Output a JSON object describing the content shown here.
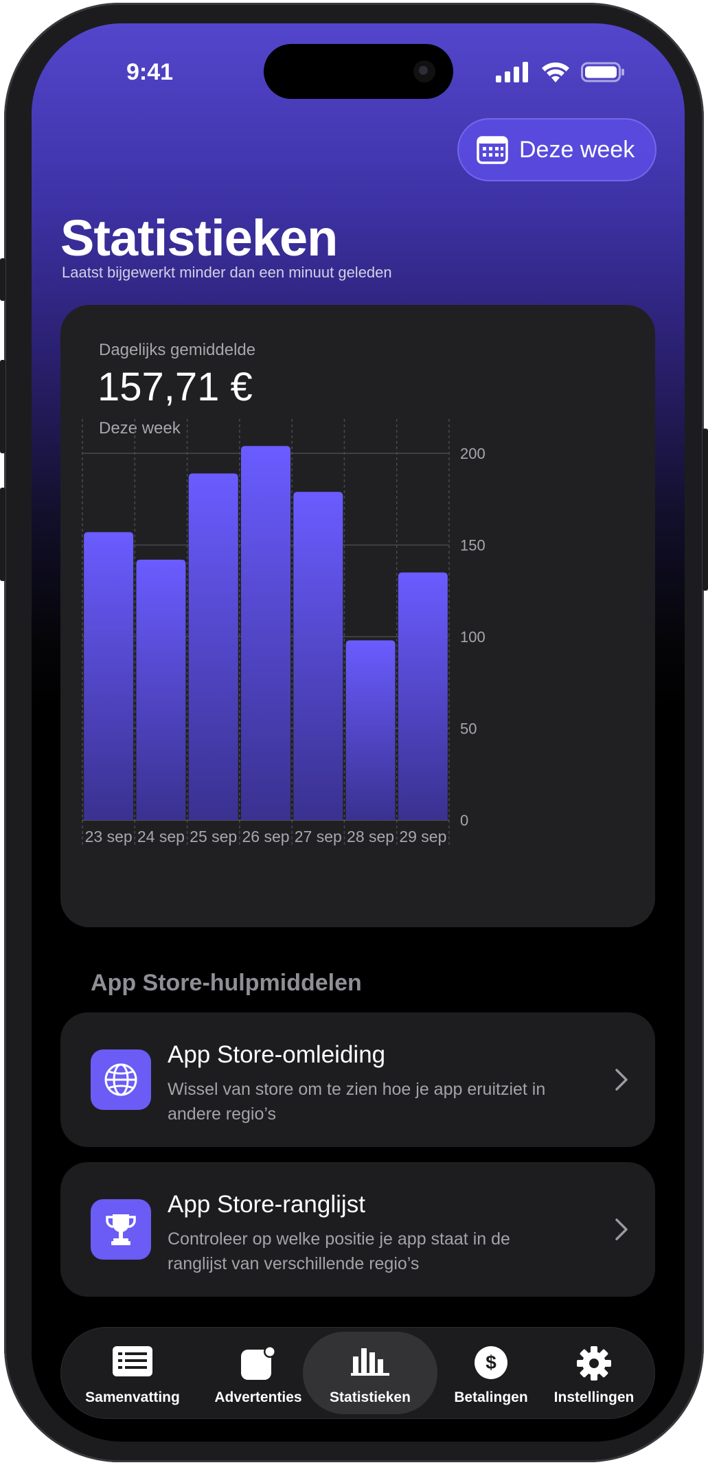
{
  "status_bar": {
    "time": "9:41"
  },
  "header": {
    "period_button_label": "Deze week",
    "title": "Statistieken",
    "subtitle": "Laatst bijgewerkt minder dan een minuut geleden"
  },
  "summary": {
    "label": "Dagelijks gemiddelde",
    "value": "157,71 €",
    "period": "Deze week"
  },
  "chart_data": {
    "type": "bar",
    "categories": [
      "23 sep",
      "24 sep",
      "25 sep",
      "26 sep",
      "27 sep",
      "28 sep",
      "29 sep"
    ],
    "values": [
      157,
      142,
      189,
      204,
      179,
      98,
      135
    ],
    "ylim": [
      0,
      200
    ],
    "yticks": [
      0,
      50,
      100,
      150,
      200
    ],
    "y_axis_side": "right",
    "grid": true,
    "bar_color_top": "#6a5cff",
    "bar_color_bottom": "#3a3190"
  },
  "tools": {
    "section_title": "App Store-hulpmiddelen",
    "items": [
      {
        "title": "App Store-omleiding",
        "description": "Wissel van store om te zien hoe je app eruitziet in andere regio’s",
        "icon": "globe-icon"
      },
      {
        "title": "App Store-ranglijst",
        "description": "Controleer op welke positie je app staat in de ranglijst van verschillende regio’s",
        "icon": "trophy-icon"
      }
    ]
  },
  "tabbar": {
    "items": [
      {
        "label": "Samenvatting",
        "icon": "list-icon"
      },
      {
        "label": "Advertenties",
        "icon": "app-badge-icon"
      },
      {
        "label": "Statistieken",
        "icon": "bar-chart-icon",
        "active": true
      },
      {
        "label": "Betalingen",
        "icon": "dollar-icon"
      },
      {
        "label": "Instellingen",
        "icon": "gear-icon"
      }
    ]
  },
  "colors": {
    "accent": "#6a5cf5",
    "card_background": "#202022",
    "header_gradient_top": "#5446cc"
  }
}
